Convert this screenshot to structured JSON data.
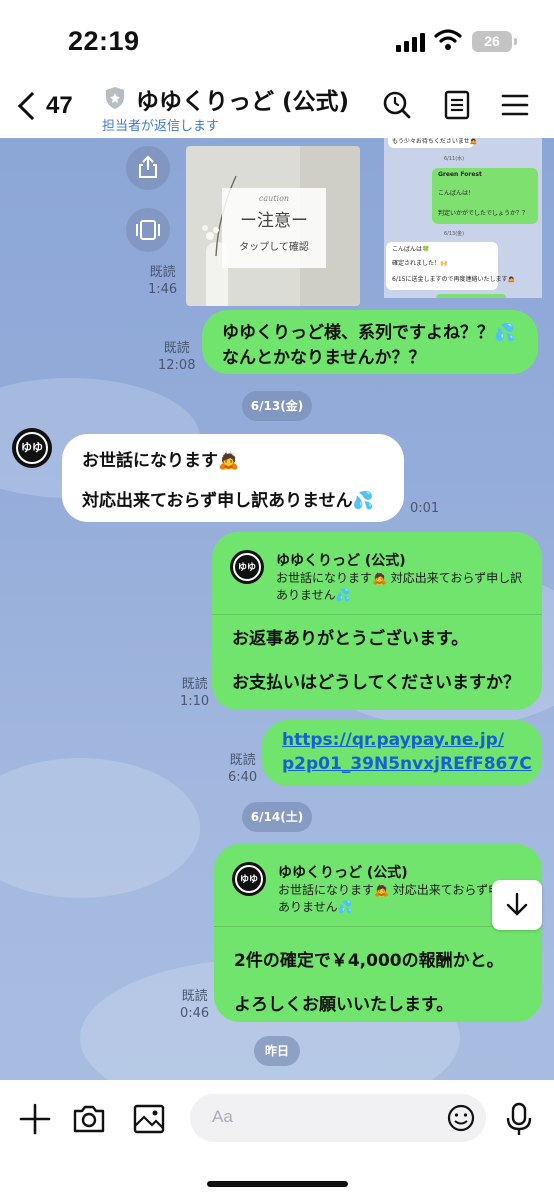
{
  "status_bar": {
    "time": "22:19",
    "battery": "26"
  },
  "header": {
    "back_count": "47",
    "title": "ゆゆくりっど (公式)",
    "subtitle": "担当者が返信します",
    "icons": [
      "back-chevron-icon",
      "shield-icon",
      "search-icon",
      "notes-icon",
      "menu-icon"
    ]
  },
  "image_message": {
    "caution_word": "caution",
    "main_text": "ー注意ー",
    "sub_text": "タップして確認",
    "read_label": "既読",
    "time": "1:46"
  },
  "screenshot_message": {
    "line1": "もう少々お待ちくださいませ🙇",
    "date1": "6/11(水)",
    "sender": "Green Forest",
    "line2": "こんばんは！",
    "line3": "判定いかがでしたでしょうか？？",
    "date2": "6/13(金)",
    "line4": "こんばんは🍀",
    "line5": "確定されました！🙌",
    "line6": "6/15に送金しますので再度連絡いたします🙇"
  },
  "messages": [
    {
      "id": "m1",
      "type": "sent",
      "lines": [
        "ゆゆくりっど様、系列ですよね？？💦",
        "なんとかなりませんか？？"
      ],
      "read_label": "既読",
      "time": "12:08"
    },
    {
      "id": "d1",
      "type": "date",
      "label": "6/13(金)"
    },
    {
      "id": "m2",
      "type": "received",
      "lines": [
        "お世話になります🙇",
        "対応出来ておらず申し訳ありません💦"
      ],
      "time": "0:01"
    },
    {
      "id": "m3",
      "type": "sent-reply",
      "reply_name": "ゆゆくりっど (公式)",
      "reply_quote": [
        "お世話になります🙇 対応出来ておらず申し訳",
        "ありません💦"
      ],
      "lines": [
        "お返事ありがとうございます。",
        "お支払いはどうしてくださいますか？"
      ],
      "read_label": "既読",
      "time": "1:10"
    },
    {
      "id": "m4",
      "type": "sent-link",
      "link_lines": [
        "https://qr.paypay.ne.jp/",
        "p2p01_39N5nvxjREfF867C"
      ],
      "read_label": "既読",
      "time": "6:40"
    },
    {
      "id": "d2",
      "type": "date",
      "label": "6/14(土)"
    },
    {
      "id": "m5",
      "type": "sent-reply",
      "reply_name": "ゆゆくりっど (公式)",
      "reply_quote": [
        "お世話になります🙇 対応出来ておらず申し訳",
        "ありません💦"
      ],
      "lines": [
        "2件の確定で￥4,000の報酬かと。",
        "よろしくお願いいたします。"
      ],
      "read_label": "既読",
      "time": "0:46"
    },
    {
      "id": "d3",
      "type": "date",
      "label": "昨日"
    }
  ],
  "avatar_text": "ゆゆ",
  "input_bar": {
    "placeholder": "Aa",
    "icons": [
      "plus-icon",
      "camera-icon",
      "image-icon",
      "emoji-icon",
      "microphone-icon"
    ]
  },
  "colors": {
    "sent_bubble": "#71e46e",
    "received_bubble": "#ffffff",
    "chat_background": "#94acd9",
    "link": "#1660d6",
    "subtitle": "#3d78d8"
  }
}
